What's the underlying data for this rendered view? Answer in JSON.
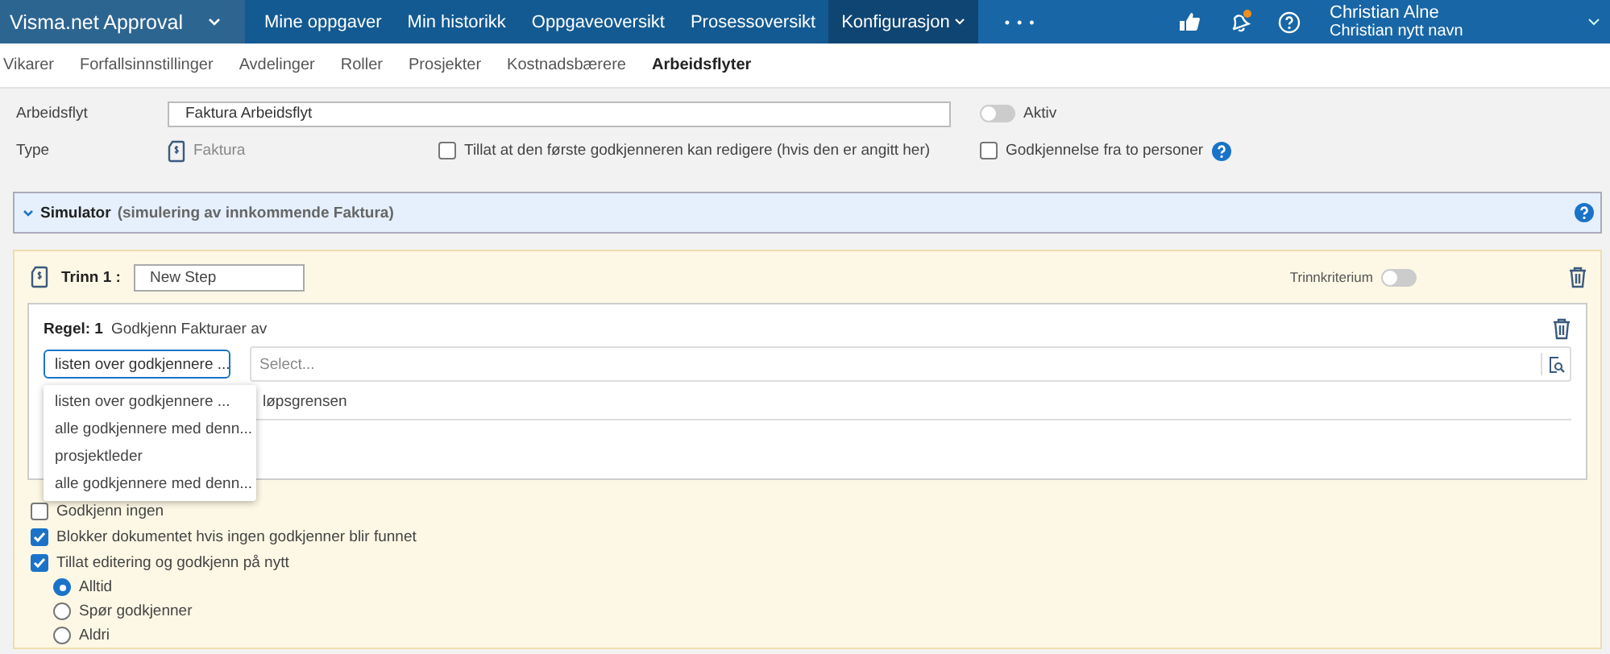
{
  "app": {
    "title": "Visma.net Approval",
    "nav": [
      {
        "label": "Mine oppgaver",
        "selected": false,
        "has_menu": false
      },
      {
        "label": "Min historikk",
        "selected": false,
        "has_menu": false
      },
      {
        "label": "Oppgaveoversikt",
        "selected": false,
        "has_menu": false
      },
      {
        "label": "Prosessoversikt",
        "selected": false,
        "has_menu": false
      },
      {
        "label": "Konfigurasjon",
        "selected": true,
        "has_menu": true
      }
    ],
    "more": "• • •",
    "notifications_unread": true,
    "user": {
      "name": "Christian Alne",
      "subtitle": "Christian nytt navn"
    }
  },
  "subnav": [
    {
      "label": "Vikarer",
      "selected": false
    },
    {
      "label": "Forfallsinnstillinger",
      "selected": false
    },
    {
      "label": "Avdelinger",
      "selected": false
    },
    {
      "label": "Roller",
      "selected": false
    },
    {
      "label": "Prosjekter",
      "selected": false
    },
    {
      "label": "Kostnadsbærere",
      "selected": false
    },
    {
      "label": "Arbeidsflyter",
      "selected": true
    }
  ],
  "form": {
    "workflow_label": "Arbeidsflyt",
    "workflow_value": "Faktura Arbeidsflyt",
    "active": {
      "label": "Aktiv",
      "on": false
    },
    "type_label": "Type",
    "type_value": "Faktura",
    "options": [
      {
        "label": "Tillat at den første godkjenneren kan redigere (hvis den er angitt her)",
        "checked": false,
        "help": false
      },
      {
        "label": "Godkjennelse fra to personer",
        "checked": false,
        "help": true
      }
    ]
  },
  "simulator": {
    "title": "Simulator",
    "subtitle": "(simulering av innkommende Faktura)"
  },
  "step": {
    "label": "Trinn 1 :",
    "name": "New Step",
    "criterion": {
      "label": "Trinnkriterium",
      "on": false
    },
    "rule": {
      "label": "Regel: 1",
      "title": "Godkjenn Fakturaer av",
      "selector": "listen over godkjennere ...",
      "field_placeholder": "Select...",
      "partial_text": "løpsgrensen",
      "menu": [
        {
          "label": "listen over godkjennere ...",
          "selected": false
        },
        {
          "label": "alle godkjennere med denn...",
          "selected": false
        },
        {
          "label": "prosjektleder",
          "selected": false
        },
        {
          "label": "alle godkjennere med denn...",
          "selected": false
        }
      ]
    },
    "checks": [
      {
        "label": "Godkjenn ingen",
        "checked": false
      },
      {
        "label": "Blokker dokumentet hvis ingen godkjenner blir funnet",
        "checked": true
      },
      {
        "label": "Tillat editering og godkjenn på nytt",
        "checked": true
      }
    ],
    "radios": [
      {
        "label": "Alltid",
        "selected": true
      },
      {
        "label": "Spør godkjenner",
        "selected": false
      },
      {
        "label": "Aldri",
        "selected": false
      }
    ]
  }
}
